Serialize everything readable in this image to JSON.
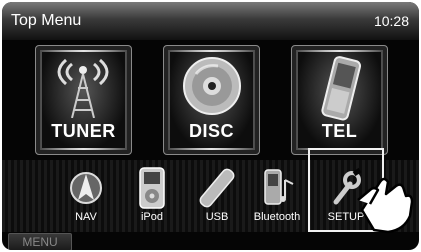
{
  "header": {
    "title": "Top Menu",
    "time": "10:28"
  },
  "main_tiles": [
    {
      "label": "TUNER",
      "icon": "tuner-tower-icon"
    },
    {
      "label": "DISC",
      "icon": "disc-icon"
    },
    {
      "label": "TEL",
      "icon": "phone-icon"
    }
  ],
  "small_items": [
    {
      "label": "NAV",
      "icon": "nav-compass-icon"
    },
    {
      "label": "iPod",
      "icon": "ipod-icon"
    },
    {
      "label": "USB",
      "icon": "usb-stick-icon"
    },
    {
      "label": "Bluetooth",
      "icon": "bluetooth-audio-icon"
    },
    {
      "label": "SETUP",
      "icon": "wrench-icon"
    }
  ],
  "footer": {
    "menu_label": "MENU"
  },
  "colors": {
    "background": "#050505",
    "label": "#ffffff",
    "highlight_frame": "#f2f2f2"
  }
}
